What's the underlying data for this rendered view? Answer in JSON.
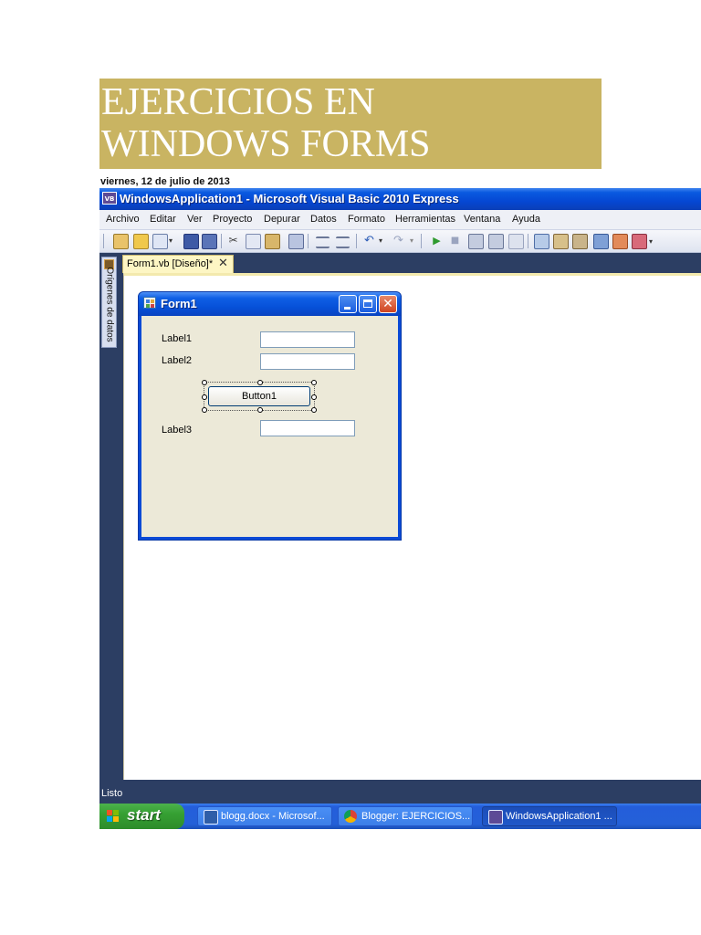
{
  "blog": {
    "title_line1": "EJERCICIOS EN",
    "title_line2": "WINDOWS FORMS",
    "date": "viernes, 12 de julio de 2013"
  },
  "vs": {
    "window_title": "WindowsApplication1 - Microsoft Visual Basic 2010 Express",
    "app_icon": "VB",
    "menu": [
      "Archivo",
      "Editar",
      "Ver",
      "Proyecto",
      "Depurar",
      "Datos",
      "Formato",
      "Herramientas",
      "Ventana",
      "Ayuda"
    ],
    "side_panel_label": "Orígenes de datos",
    "doc_tab_label": "Form1.vb [Diseño]*",
    "tab_close_glyph": "✕",
    "status": "Listo"
  },
  "form1": {
    "title": "Form1",
    "close_glyph": "✕",
    "label1": "Label1",
    "label2": "Label2",
    "label3": "Label3",
    "button1": "Button1"
  },
  "taskbar": {
    "start_label": "start",
    "items": [
      {
        "label": "blogg.docx - Microsof...",
        "icon": "word-document-icon"
      },
      {
        "label": "Blogger: EJERCICIOS...",
        "icon": "chrome-icon"
      },
      {
        "label": "WindowsApplication1 ...",
        "icon": "visual-basic-icon"
      }
    ]
  },
  "colors": {
    "blog_header": "#c9b462",
    "titlebar_blue": "#0a5ae0",
    "ide_background": "#2c3e63",
    "form_client": "#ece9d8",
    "start_green": "#36a033"
  }
}
